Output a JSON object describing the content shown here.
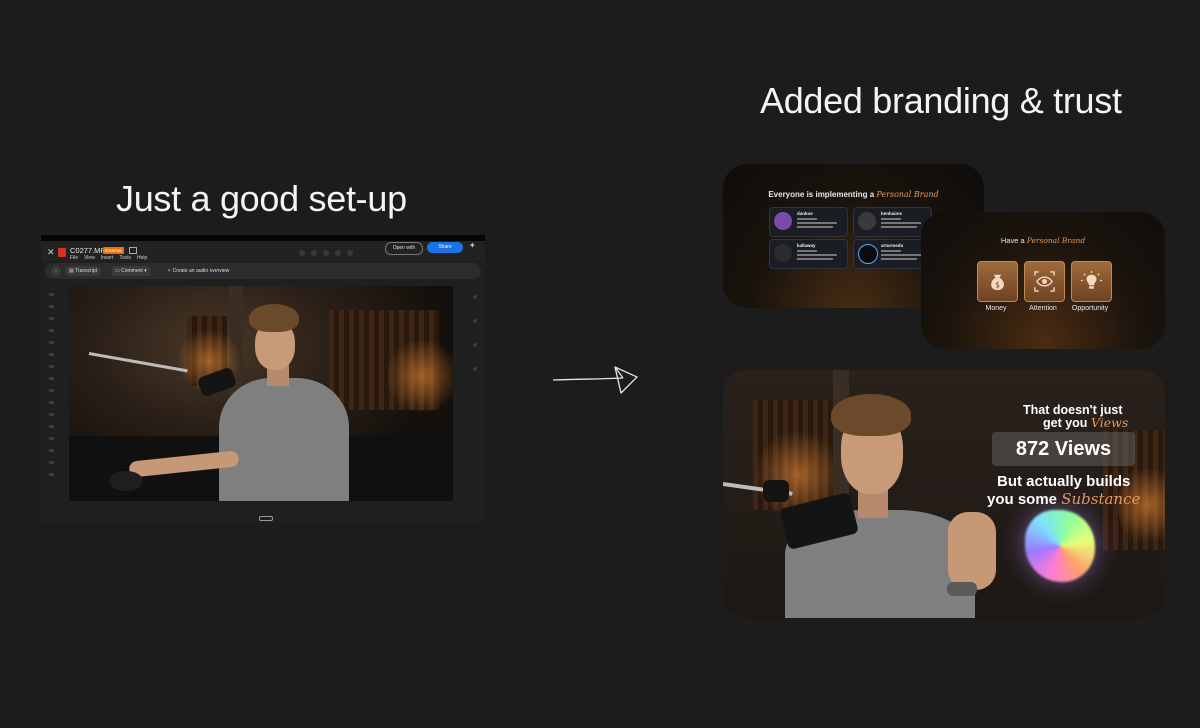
{
  "left": {
    "heading": "Just a good set-up",
    "viewer": {
      "file_name": "C0277.MP4",
      "badge": "External",
      "menu": [
        "File",
        "View",
        "Insert",
        "Tools",
        "Help"
      ],
      "open_with": "Open with",
      "share": "Share",
      "transcript": "Transcript",
      "comment": "Comment",
      "audio_overview": "Create an audio overview"
    }
  },
  "right": {
    "heading": "Added branding & trust",
    "brand_slide": {
      "title_prefix": "Everyone is implementing a",
      "title_accent": "Personal Brand",
      "cards": [
        {
          "name": "dankoe"
        },
        {
          "name": "benhaims"
        },
        {
          "name": "kallaway"
        },
        {
          "name": "arturmedu"
        }
      ]
    },
    "have_slide": {
      "title_prefix": "Have a",
      "title_accent": "Personal Brand",
      "tiles": [
        {
          "label": "Money",
          "icon": "money-bag-icon"
        },
        {
          "label": "Attention",
          "icon": "eye-icon"
        },
        {
          "label": "Opportunity",
          "icon": "lightbulb-icon"
        }
      ]
    },
    "views_slide": {
      "line1": "That doesn't just",
      "line2_prefix": "get you",
      "line2_accent": "Views",
      "views_count": "872 Views",
      "line3": "But actually builds",
      "line4_prefix": "you some",
      "line4_accent": "Substance"
    }
  },
  "colors": {
    "background": "#1c1c1c",
    "accent": "#e29a5c",
    "share_blue": "#1a73e8"
  }
}
